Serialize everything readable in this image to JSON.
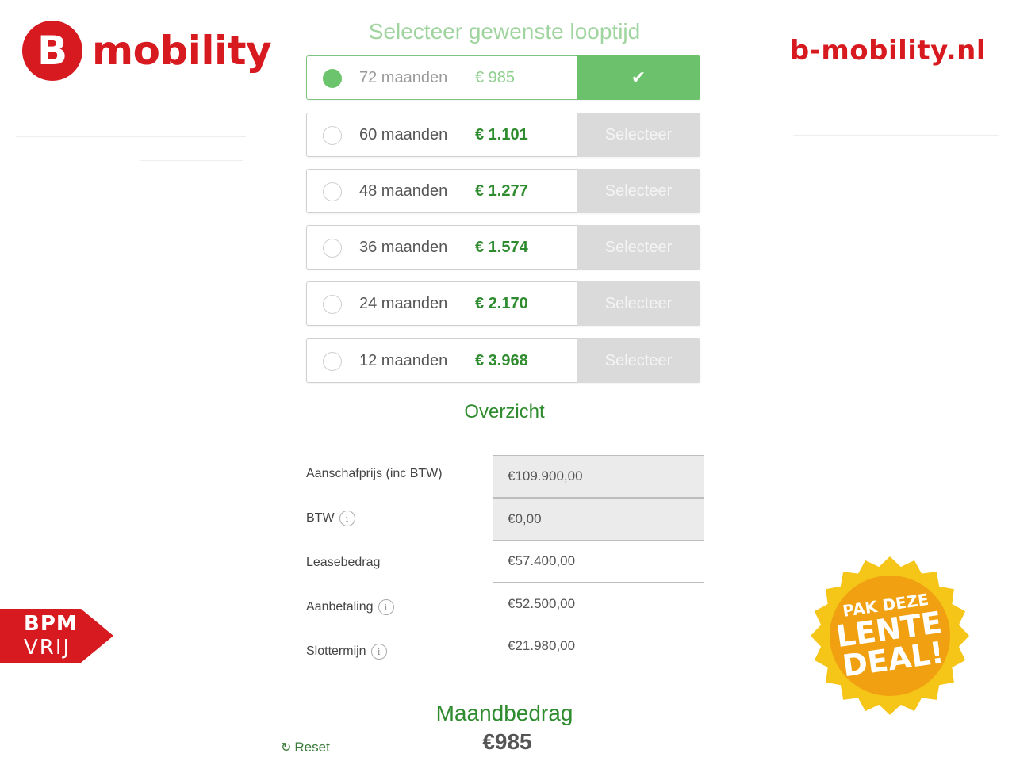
{
  "brand": {
    "logo_letter": "B",
    "logo_text": "mobility",
    "url": "b-mobility.nl",
    "color": "#d71920"
  },
  "selector": {
    "title": "Selecteer gewenste looptijd",
    "options": [
      {
        "months": "72 maanden",
        "price": "€ 985",
        "button": "✔",
        "selected": true
      },
      {
        "months": "60 maanden",
        "price": "€ 1.101",
        "button": "Selecteer",
        "selected": false
      },
      {
        "months": "48 maanden",
        "price": "€ 1.277",
        "button": "Selecteer",
        "selected": false
      },
      {
        "months": "36 maanden",
        "price": "€ 1.574",
        "button": "Selecteer",
        "selected": false
      },
      {
        "months": "24 maanden",
        "price": "€ 2.170",
        "button": "Selecteer",
        "selected": false
      },
      {
        "months": "12 maanden",
        "price": "€ 3.968",
        "button": "Selecteer",
        "selected": false
      }
    ]
  },
  "overview": {
    "title": "Overzicht",
    "rows": [
      {
        "label": "Aanschafprijs (inc BTW)",
        "value": "€109.900,00",
        "info": false,
        "readonly": true
      },
      {
        "label": "BTW",
        "value": "€0,00",
        "info": true,
        "readonly": true
      },
      {
        "label": "Leasebedrag",
        "value": "€57.400,00",
        "info": false,
        "readonly": false
      },
      {
        "label": "Aanbetaling",
        "value": "€52.500,00",
        "info": true,
        "readonly": false
      },
      {
        "label": "Slottermijn",
        "value": "€21.980,00",
        "info": true,
        "readonly": false
      }
    ],
    "info_glyph": "i"
  },
  "monthly": {
    "title": "Maandbedrag",
    "value": "€985"
  },
  "reset": {
    "icon": "refresh-icon",
    "label": "Reset"
  },
  "badges": {
    "bpm_line1": "BPM",
    "bpm_line2": "VRIJ",
    "deal_line1": "PAK DEZE",
    "deal_line2": "LENTE",
    "deal_line3": "DEAL!"
  },
  "colors": {
    "accent_green": "#2e8b2e",
    "selected_green": "#6cc26c",
    "button_grey": "#dadada",
    "badge_orange": "#f0a010",
    "badge_yellow": "#f5c518"
  }
}
